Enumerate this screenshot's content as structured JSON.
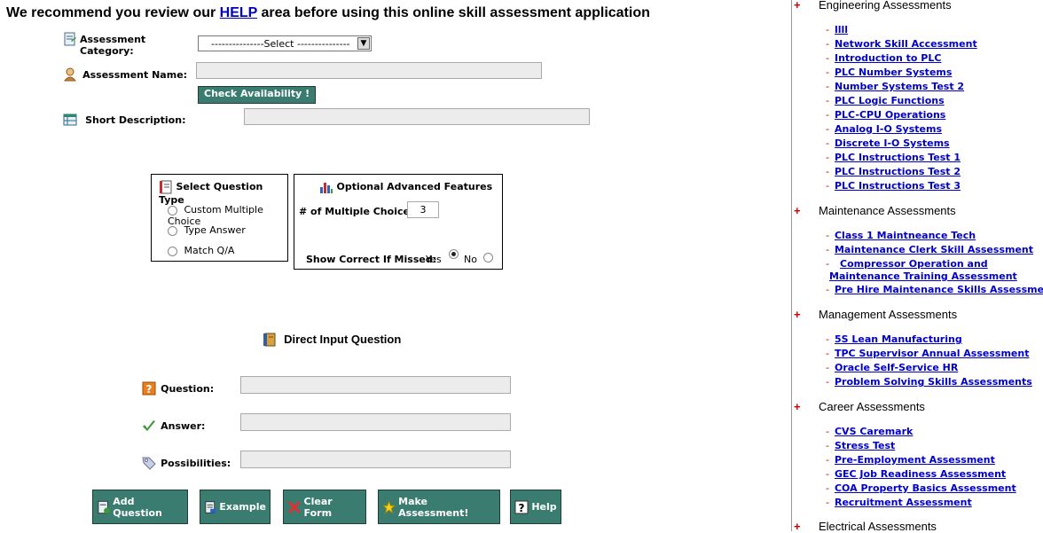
{
  "banner": {
    "before": "We recommend you review our",
    "link": "HELP",
    "after": "area before using this online skill assessment application"
  },
  "form": {
    "category_label": "Assessment Category:",
    "category_select": "---------------Select ---------------",
    "name_label": "Assessment Name:",
    "check_button": "Check Availability !",
    "desc_label": "Short Description:"
  },
  "qtype": {
    "title": "Select Question Type",
    "options": [
      "Custom Multiple Choice",
      "Type Answer",
      "Match Q/A"
    ]
  },
  "advanced": {
    "title": "Optional Advanced Features",
    "choices_label": "# of Multiple Choices:",
    "choices_value": "3",
    "show_label": "Show Correct If Missed:",
    "yes": "Yes",
    "no": "No"
  },
  "direct": {
    "title": "Direct Input Question",
    "question_label": "Question:",
    "answer_label": "Answer:",
    "possibilities_label": "Possibilities:"
  },
  "buttons": {
    "add": "Add Question",
    "example": "Example",
    "clear": "Clear Form",
    "make": "Make Assessment!",
    "help": "Help"
  },
  "sidebar": {
    "engineering": {
      "title": "Engineering Assessments",
      "items": [
        "llll",
        "Network Skill Accessment",
        "Introduction to PLC",
        "PLC Number Systems",
        "Number Systems Test 2",
        "PLC Logic Functions",
        "PLC-CPU Operations",
        "Analog I-O Systems",
        "Discrete I-O Systems",
        "PLC Instructions Test 1",
        "PLC Instructions Test 2",
        "PLC Instructions Test 3"
      ]
    },
    "maintenance": {
      "title": "Maintenance Assessments",
      "items": [
        "Class 1 Maintneance Tech",
        "Maintenance Clerk Skill Assessment",
        "Compressor Operation and Maintenance Training Assessment",
        "Pre Hire Maintenance Skills Assessment"
      ]
    },
    "management": {
      "title": "Management Assessments",
      "items": [
        "5S Lean Manufacturing",
        "TPC Supervisor Annual Assessment",
        "Oracle Self-Service HR",
        "Problem Solving Skills Assessments"
      ]
    },
    "career": {
      "title": "Career Assessments",
      "items": [
        "CVS Caremark",
        "Stress Test",
        "Pre-Employment Assessment",
        "GEC Job Readiness Assessment",
        "COA Property Basics Assessment",
        "Recruitment Assessment"
      ]
    },
    "electrical": {
      "title": "Electrical Assessments"
    },
    "plus": "+",
    "dash": "-"
  }
}
